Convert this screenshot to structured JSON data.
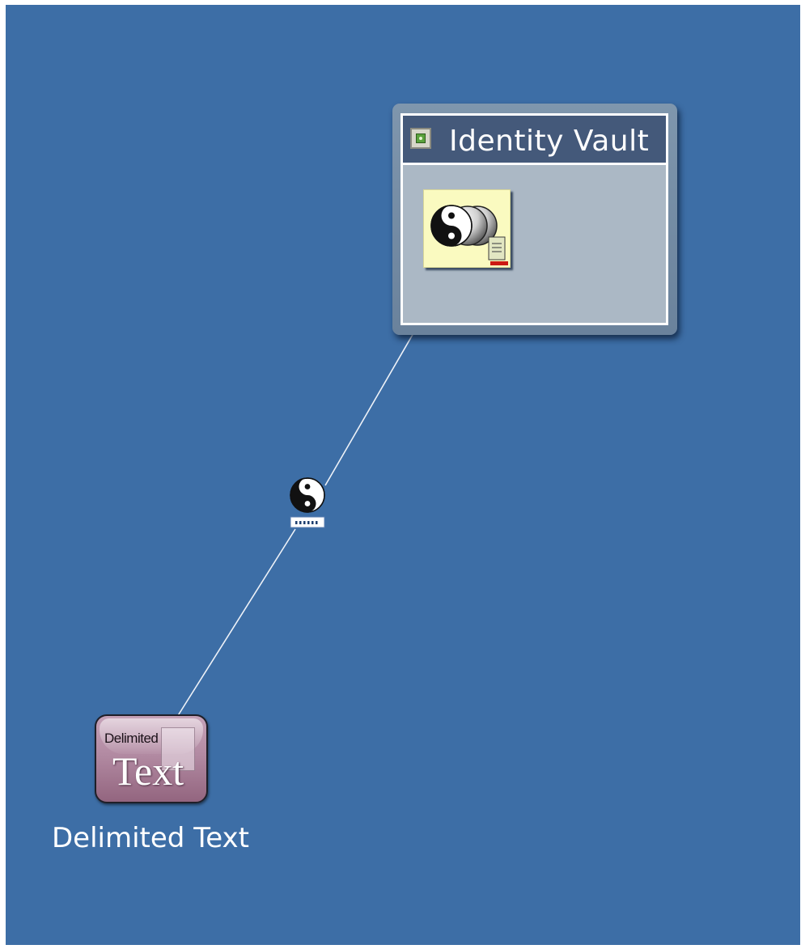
{
  "canvas": {
    "background": "#3d6ea6"
  },
  "vault": {
    "title": "Identity Vault"
  },
  "app": {
    "icon_small_text": "Delimited",
    "icon_big_text": "Text",
    "caption": "Delimited Text"
  },
  "icons": {
    "vault_header": "directory-container-icon",
    "driverset": "driver-set-icon",
    "driver": "driver-yin-yang-icon",
    "app": "delimited-text-app-icon"
  }
}
